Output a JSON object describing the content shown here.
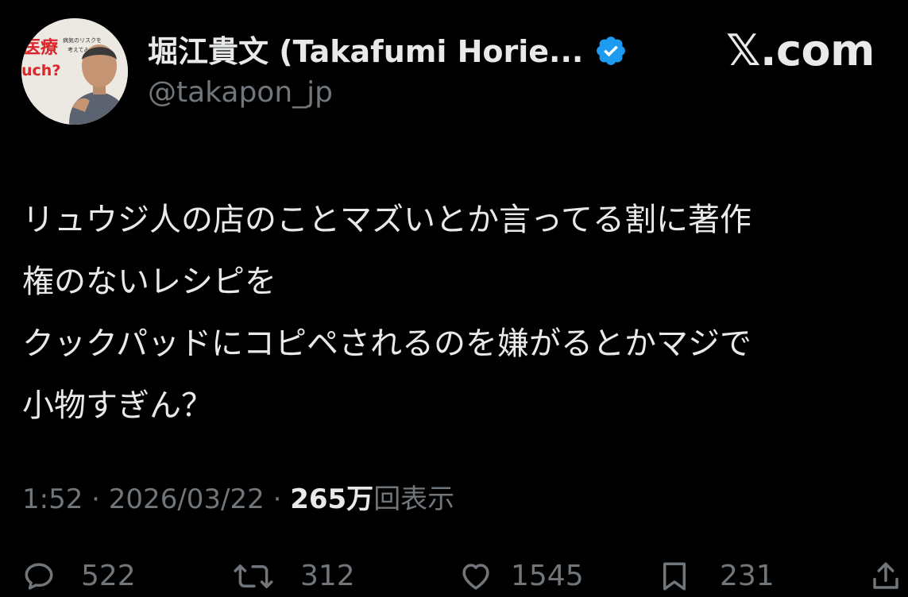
{
  "author": {
    "display_name": "堀江貴文 (Takafumi Horie...",
    "handle": "@takapon_jp",
    "verified_icon": "verified-badge-icon",
    "avatar_book_text": [
      "医療",
      "uch?",
      "病気のリスクを",
      "考えてみた"
    ]
  },
  "site": {
    "logo_text": "𝕏.com"
  },
  "tweet": {
    "lines": [
      "リュウジ人の店のことマズいとか言ってる割に著作",
      "権のないレシピを",
      "クックパッドにコピペされるのを嫌がるとかマジで",
      "小物すぎん？"
    ]
  },
  "meta": {
    "time": "1:52",
    "sep1": " · ",
    "date": "2026/03/22",
    "sep2": " · ",
    "views_count": "265万",
    "views_label": "回表示"
  },
  "actions": {
    "reply": {
      "icon": "reply-icon",
      "count": "522"
    },
    "repost": {
      "icon": "repost-icon",
      "count": "312"
    },
    "like": {
      "icon": "heart-icon",
      "count": "1545"
    },
    "bookmark": {
      "icon": "bookmark-icon",
      "count": "231"
    },
    "share": {
      "icon": "share-icon"
    }
  },
  "colors": {
    "background": "#000000",
    "primary_text": "#e7e9ea",
    "secondary_text": "#71767b",
    "verified_blue": "#1d9bf0"
  }
}
